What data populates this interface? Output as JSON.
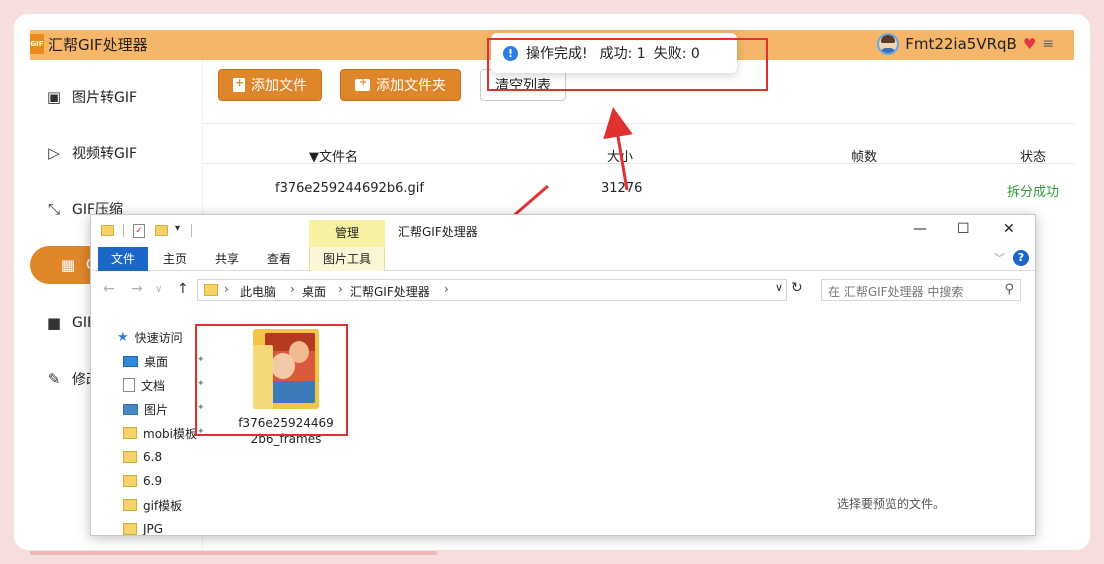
{
  "app": {
    "title": "汇帮GIF处理器",
    "logo_text": "GIF",
    "user_name": "Fmt22ia5VRqB",
    "vip_icon": "heart-vip-icon",
    "menu_icon": "hamburger-icon"
  },
  "sidebar": {
    "items": [
      {
        "label": "图片转GIF",
        "icon": "image-icon"
      },
      {
        "label": "视频转GIF",
        "icon": "play-circle-icon"
      },
      {
        "label": "GIF压缩",
        "icon": "compress-icon"
      },
      {
        "label": "G",
        "icon": "grid-icon",
        "active": true
      },
      {
        "label": "GIF",
        "icon": "video-camera-icon"
      },
      {
        "label": "修改",
        "icon": "edit-magic-icon"
      }
    ]
  },
  "toolbar": {
    "add_file": "添加文件",
    "add_folder": "添加文件夹",
    "clear_list": "清空列表"
  },
  "table": {
    "headers": [
      "文件名",
      "大小",
      "帧数",
      "状态"
    ],
    "sort_indicator": "▼",
    "rows": [
      {
        "name": "f376e259244692b6.gif",
        "size": "31276",
        "frames": "",
        "status": "拆分成功"
      }
    ]
  },
  "toast": {
    "message": "操作完成!",
    "success": "成功: 1",
    "fail": "失败: 0"
  },
  "explorer": {
    "window_title": "汇帮GIF处理器",
    "manage_tab": "管理",
    "ribbon_tabs": [
      "文件",
      "主页",
      "共享",
      "查看",
      "图片工具"
    ],
    "breadcrumb": [
      "此电脑",
      "桌面",
      "汇帮GIF处理器"
    ],
    "search_placeholder": "在 汇帮GIF处理器 中搜索",
    "nav_items": [
      "快速访问",
      "桌面",
      "文档",
      "图片",
      "mobi模板",
      "6.8",
      "6.9",
      "gif模板",
      "JPG"
    ],
    "file_item": {
      "line1": "f376e25924469",
      "line2": "2b6_frames"
    },
    "preview_hint": "选择要预览的文件。"
  },
  "colors": {
    "accent": "#e0862a",
    "header": "#f6b66a",
    "success": "#2b9a3a",
    "annotation": "#e03030"
  }
}
